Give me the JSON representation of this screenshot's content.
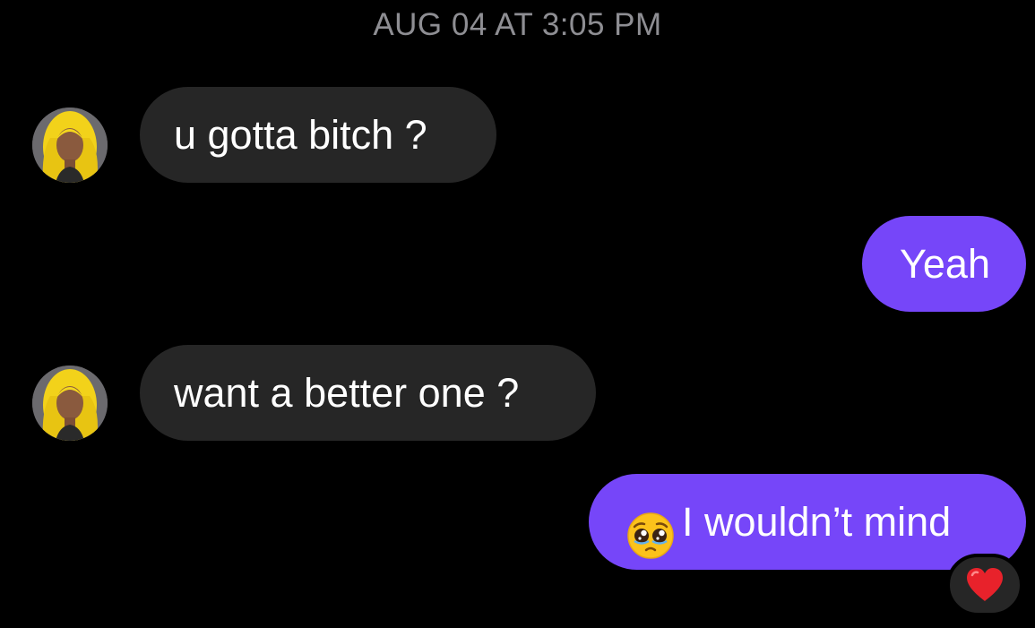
{
  "conversation": {
    "timestamp": "AUG 04 AT 3:05 PM",
    "messages": [
      {
        "direction": "incoming",
        "text": "u gotta bitch ?"
      },
      {
        "direction": "outgoing",
        "text": "Yeah"
      },
      {
        "direction": "incoming",
        "text": "want a better one ?"
      },
      {
        "direction": "outgoing",
        "emoji": "pleading-face",
        "text": "I wouldn’t mind",
        "reaction": "red-heart"
      }
    ]
  },
  "colors": {
    "background": "#000000",
    "incoming_bubble": "#262626",
    "outgoing_bubble": "#7646f9",
    "timestamp_text": "#8e8e93",
    "message_text": "#ffffff"
  }
}
